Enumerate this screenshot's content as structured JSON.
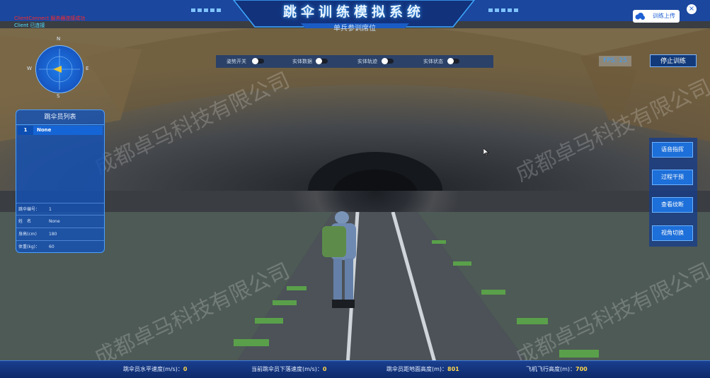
{
  "app": {
    "title": "跳伞训练模拟系统",
    "subtitle": "单兵参训席位",
    "status_red": "ClientConnect 服务器连接成功",
    "client_label": "Client 已连接",
    "upload_label": "训练上传",
    "close_label": "×"
  },
  "compass": {
    "n": "N",
    "s": "S",
    "e": "E",
    "w": "W"
  },
  "toggles": [
    {
      "label": "姿势开关"
    },
    {
      "label": "实体数据"
    },
    {
      "label": "实体轨迹"
    },
    {
      "label": "实体状态"
    }
  ],
  "fps_label": "FPS: 25",
  "stop_button": "停止训练",
  "jumper_panel": {
    "title": "跳伞员列表",
    "rows": [
      {
        "index": "1",
        "name": "None"
      }
    ],
    "info": [
      {
        "label": "跳伞编号：",
        "value": "1"
      },
      {
        "label": "姓　名",
        "value": "None"
      },
      {
        "label": "身高(cm)",
        "value": "180"
      },
      {
        "label": "体重(kg)：",
        "value": "60"
      }
    ]
  },
  "side_menu": [
    "语音指挥",
    "过程干预",
    "查看纹断",
    "视角切换"
  ],
  "bottom_stats": [
    {
      "label": "跳伞员水平速度(m/s)：",
      "value": "0"
    },
    {
      "label": "当前跳伞员下落速度(m/s)：",
      "value": "0"
    },
    {
      "label": "跳伞员距地面高度(m)：",
      "value": "801"
    },
    {
      "label": "飞机飞行高度(m)：",
      "value": "700"
    }
  ],
  "watermark": "成都卓马科技有限公司",
  "colors": {
    "accent": "#1d6fd9",
    "title_glow": "#3fa9ff",
    "value": "#ffd64a"
  }
}
